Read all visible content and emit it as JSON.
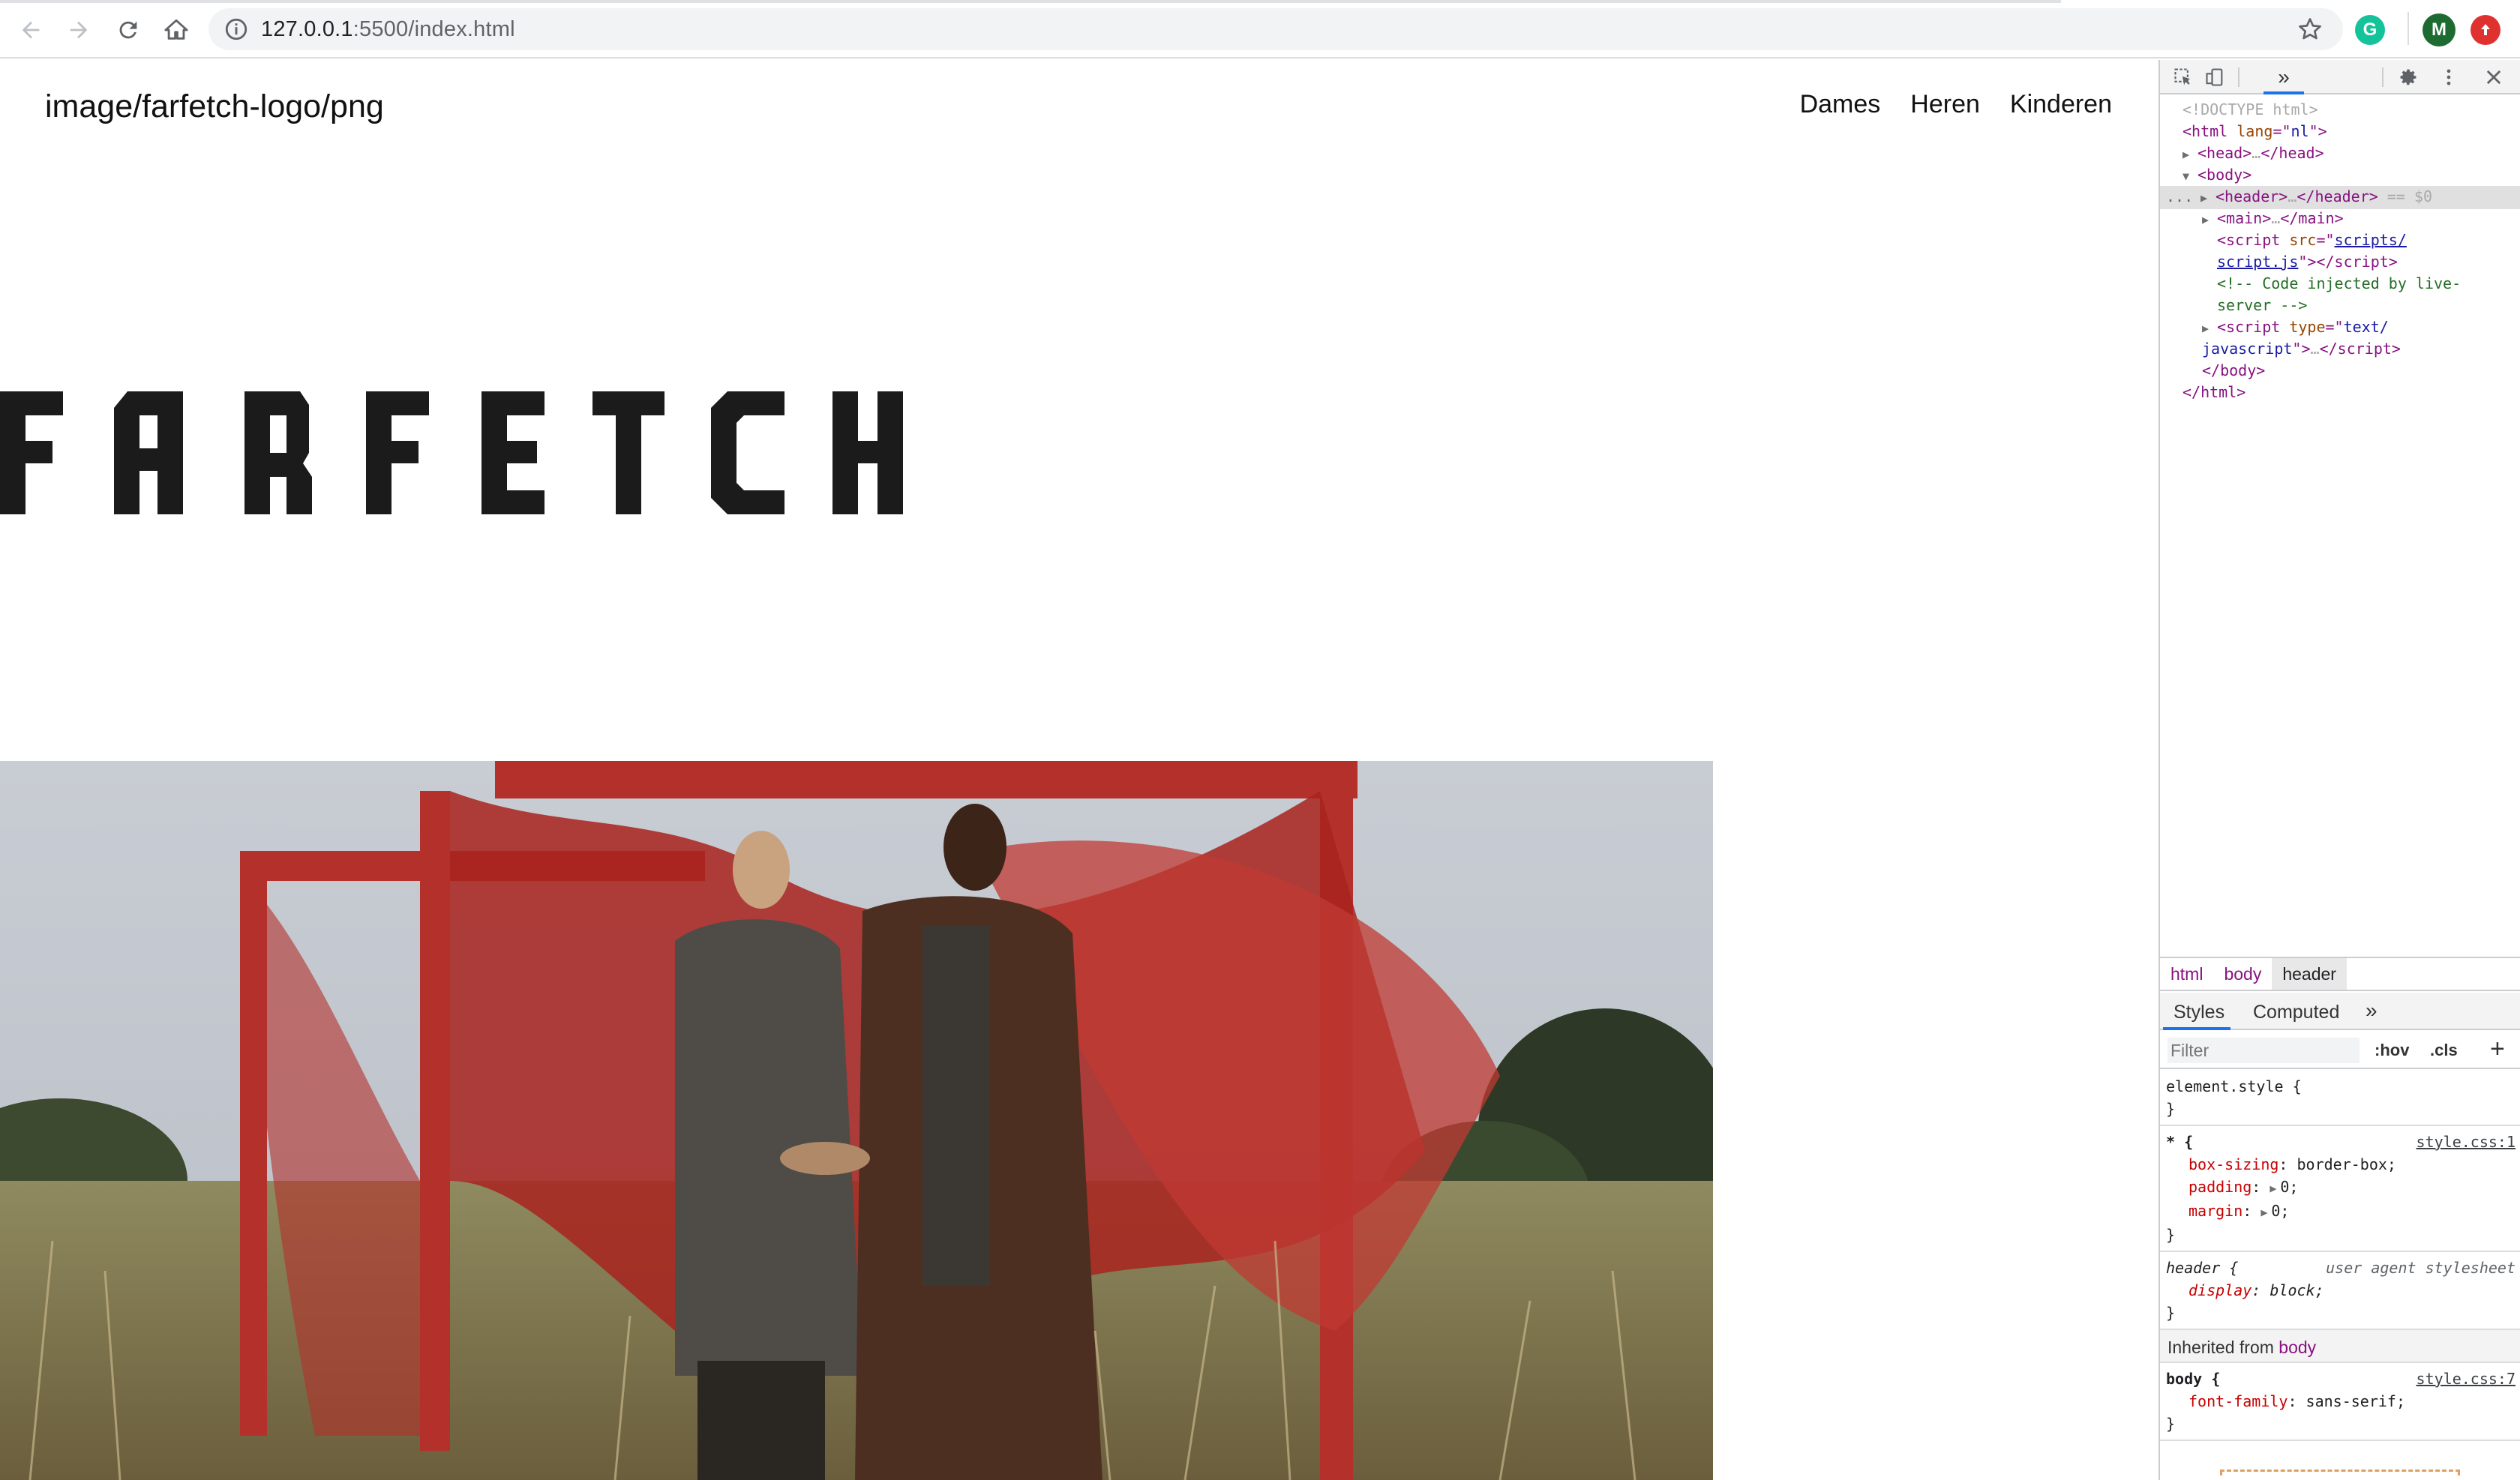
{
  "browser": {
    "url_host": "127.0.0.1",
    "url_rest": ":5500/index.html",
    "extension_g": "G",
    "profile_initial": "M",
    "colors": {
      "profile": "#1e7e34",
      "ext_g": "#15c39a",
      "ext_red": "#e03131"
    }
  },
  "page": {
    "logo_alt_text": "image/farfetch-logo/png",
    "nav": [
      "Dames",
      "Heren",
      "Kinderen"
    ],
    "brand_wordmark": "FARFETCH",
    "hero_image": "fashion-photo-red-structure"
  },
  "devtools": {
    "tree": {
      "doctype": "<!DOCTYPE html>",
      "html_open_tag": "html",
      "lang_attr": "lang",
      "lang_val": "nl",
      "head": "head",
      "body": "body",
      "header": "header",
      "selected_marker": "== $0",
      "main": "main",
      "script": "script",
      "src_attr": "src",
      "src_val_1": "scripts/",
      "src_val_2": "script.js",
      "comment_1": "<!-- Code injected by live-",
      "comment_2": "server -->",
      "type_attr": "type",
      "type_val_1": "text/",
      "type_val_2": "javascript",
      "ellipsis": "…",
      "body_close": "</body>",
      "html_close": "</html>",
      "row_dots": "..."
    },
    "breadcrumbs": [
      "html",
      "body",
      "header"
    ],
    "style_tabs": {
      "styles": "Styles",
      "computed": "Computed",
      "more": "»"
    },
    "filter_placeholder": "Filter",
    "hov": ":hov",
    "cls": ".cls",
    "plus": "+",
    "rules": {
      "element_style": "element.style {",
      "close": "}",
      "star_selector": "* {",
      "star_source": "style.css:1",
      "star_props": [
        {
          "name": "box-sizing",
          "value": "border-box;"
        },
        {
          "name": "padding",
          "value": "0;"
        },
        {
          "name": "margin",
          "value": "0;"
        }
      ],
      "header_selector": "header {",
      "header_source": "user agent stylesheet",
      "header_prop": {
        "name": "display",
        "value": "block;"
      },
      "inherited_label": "Inherited from",
      "inherited_from": "body",
      "body_selector": "body {",
      "body_source": "style.css:7",
      "body_prop": {
        "name": "font-family",
        "value": "sans-serif;"
      }
    }
  }
}
